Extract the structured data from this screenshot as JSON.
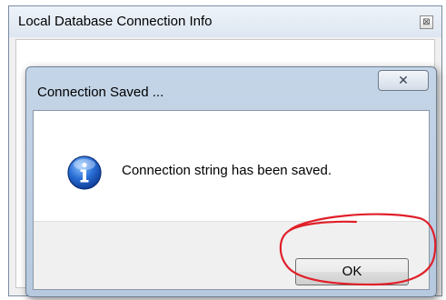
{
  "background_window": {
    "title": "Local Database Connection Info",
    "close_glyph": "⊠"
  },
  "dialog": {
    "title": "Connection Saved ...",
    "close_glyph": "✕",
    "message": "Connection string has been saved.",
    "icon": "information-icon",
    "ok_label": "OK"
  },
  "annotation": {
    "shape": "hand-drawn circle around OK button",
    "color": "#e0202a"
  }
}
